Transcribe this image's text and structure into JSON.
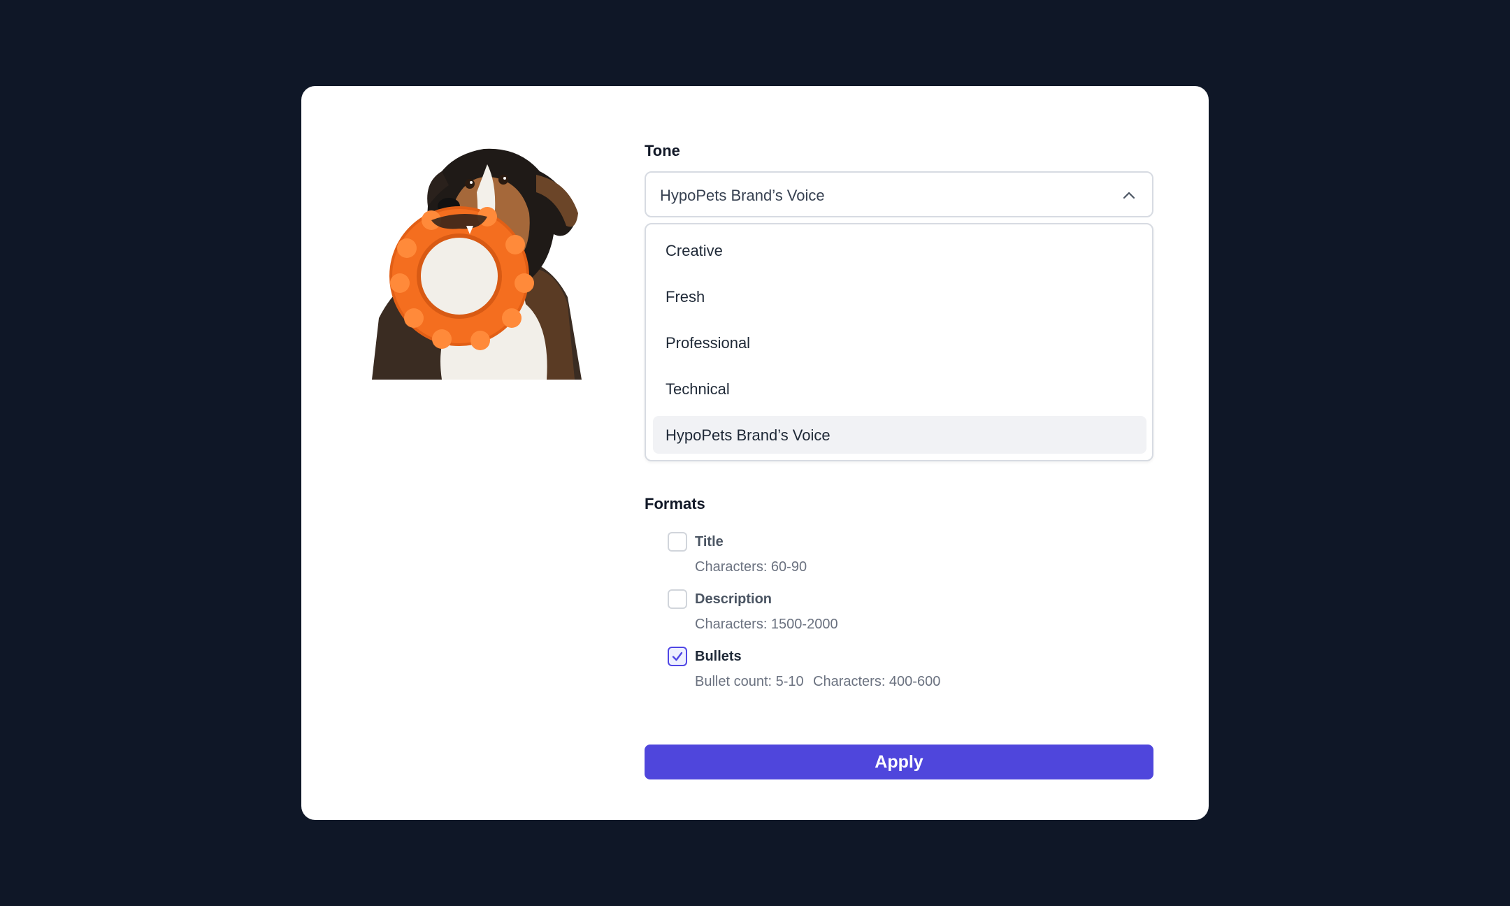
{
  "tone": {
    "label": "Tone",
    "selected": "HypoPets Brand’s Voice",
    "options": [
      {
        "label": "Creative"
      },
      {
        "label": "Fresh"
      },
      {
        "label": "Professional"
      },
      {
        "label": "Technical"
      },
      {
        "label": "HypoPets Brand’s Voice"
      }
    ]
  },
  "formats": {
    "label": "Formats",
    "items": [
      {
        "name": "Title",
        "meta": "Characters: 60-90",
        "checked": false
      },
      {
        "name": "Description",
        "meta": "Characters: 1500-2000",
        "checked": false
      },
      {
        "name": "Bullets",
        "meta": "Bullet count: 5-10",
        "meta2": "Characters: 400-600",
        "checked": true
      }
    ]
  },
  "apply_label": "Apply",
  "icons": {
    "chevron": "chevron-up-icon",
    "check": "check-icon"
  },
  "colors": {
    "background": "#0f1727",
    "card": "#ffffff",
    "accent": "#4f46dc",
    "selected_option_bg": "#f1f2f5"
  }
}
